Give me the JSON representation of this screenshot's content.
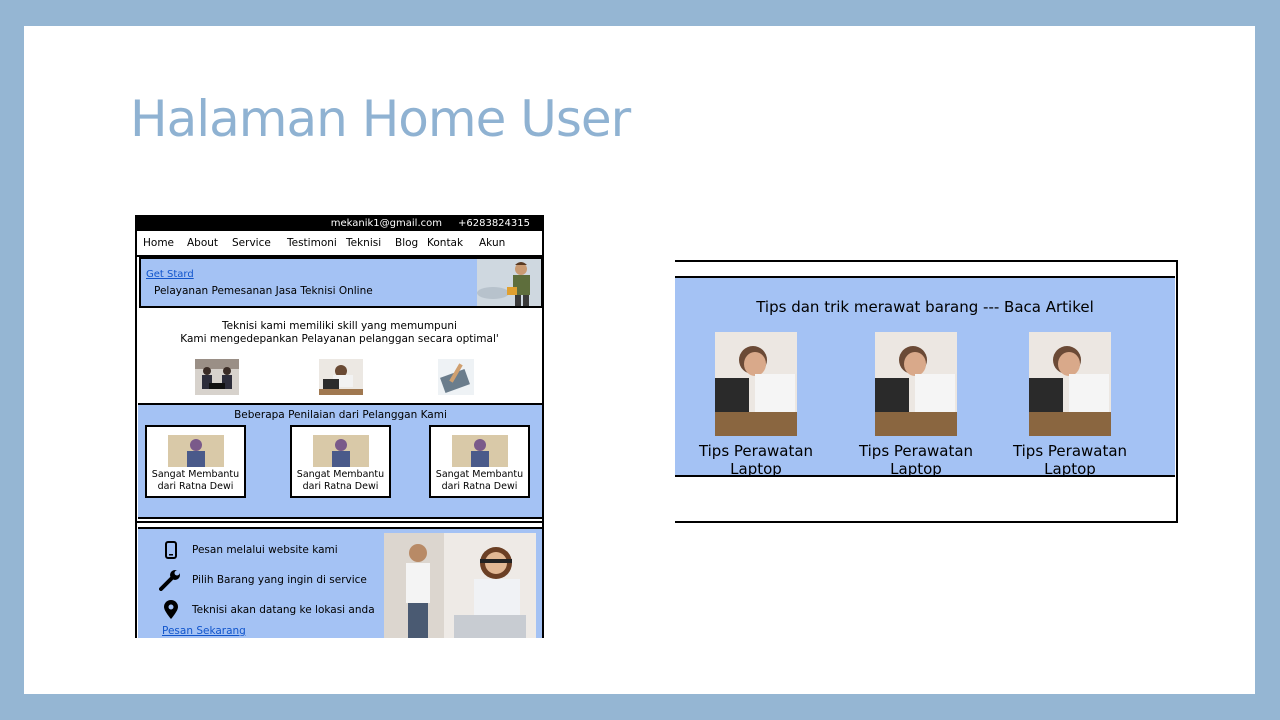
{
  "slide": {
    "title": "Halaman Home User"
  },
  "mockup": {
    "topbar": {
      "email": "mekanik1@gmail.com",
      "phone": "+6283824315"
    },
    "nav": [
      "Home",
      "About",
      "Service",
      "Testimoni",
      "Teknisi",
      "Blog",
      "Kontak",
      "Akun"
    ],
    "hero": {
      "link": "Get Stard",
      "text": "Pelayanan Pemesanan Jasa Teknisi Online"
    },
    "intro": {
      "line1": "Teknisi kami memiliki skill yang memumpuni",
      "line2": "Kami mengedepankan Pelayanan pelanggan secara optimal'"
    },
    "reviews": {
      "title": "Beberapa Penilaian dari Pelanggan Kami",
      "cards": [
        {
          "line1": "Sangat Membantu",
          "line2": "dari Ratna Dewi"
        },
        {
          "line1": "Sangat Membantu",
          "line2": "dari Ratna Dewi"
        },
        {
          "line1": "Sangat Membantu",
          "line2": "dari Ratna Dewi"
        }
      ]
    },
    "steps": [
      {
        "icon": "phone-icon",
        "text": "Pesan melalui website kami"
      },
      {
        "icon": "wrench-icon",
        "text": "Pilih Barang yang ingin di service"
      },
      {
        "icon": "location-pin-icon",
        "text": "Teknisi akan datang ke lokasi anda"
      }
    ],
    "cta": "Pesan Sekarang"
  },
  "tips": {
    "title": "Tips dan trik merawat barang   --- Baca Artikel",
    "cards": [
      {
        "label": "Tips Perawatan Laptop"
      },
      {
        "label": "Tips Perawatan Laptop"
      },
      {
        "label": "Tips Perawatan Laptop"
      }
    ]
  },
  "colors": {
    "frame": "#95b6d3",
    "title": "#8fb2d2",
    "panel": "#a4c2f4",
    "link": "#1155cc"
  }
}
